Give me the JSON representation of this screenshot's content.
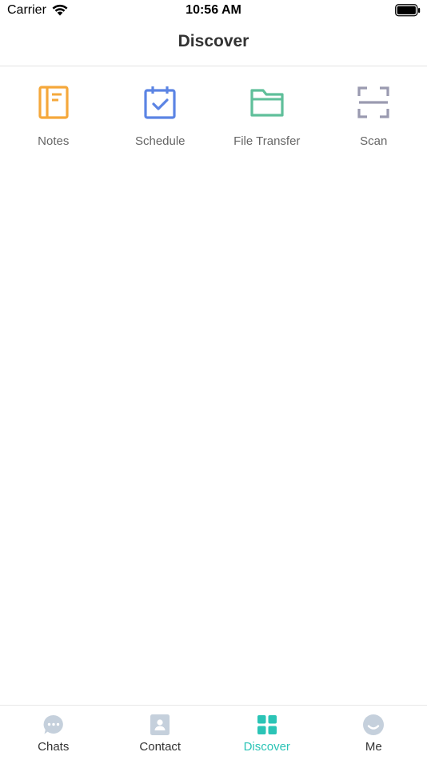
{
  "status_bar": {
    "carrier": "Carrier",
    "time": "10:56 AM",
    "wifi_icon": "wifi-icon",
    "battery_icon": "battery-icon"
  },
  "nav": {
    "title": "Discover"
  },
  "features": [
    {
      "label": "Notes",
      "icon": "notebook-icon",
      "color": "#f5a83b"
    },
    {
      "label": "Schedule",
      "icon": "calendar-check-icon",
      "color": "#5b84e4"
    },
    {
      "label": "File Transfer",
      "icon": "folder-icon",
      "color": "#5fbf9a"
    },
    {
      "label": "Scan",
      "icon": "scan-icon",
      "color": "#9a9ab0"
    }
  ],
  "tabs": [
    {
      "label": "Chats",
      "icon": "chat-bubble-icon",
      "active": false
    },
    {
      "label": "Contact",
      "icon": "contact-card-icon",
      "active": false
    },
    {
      "label": "Discover",
      "icon": "grid-icon",
      "active": true
    },
    {
      "label": "Me",
      "icon": "smiley-icon",
      "active": false
    }
  ],
  "colors": {
    "accent": "#2bc4b6",
    "tab_inactive_icon": "#c5d0dc",
    "label_gray": "#666666"
  }
}
